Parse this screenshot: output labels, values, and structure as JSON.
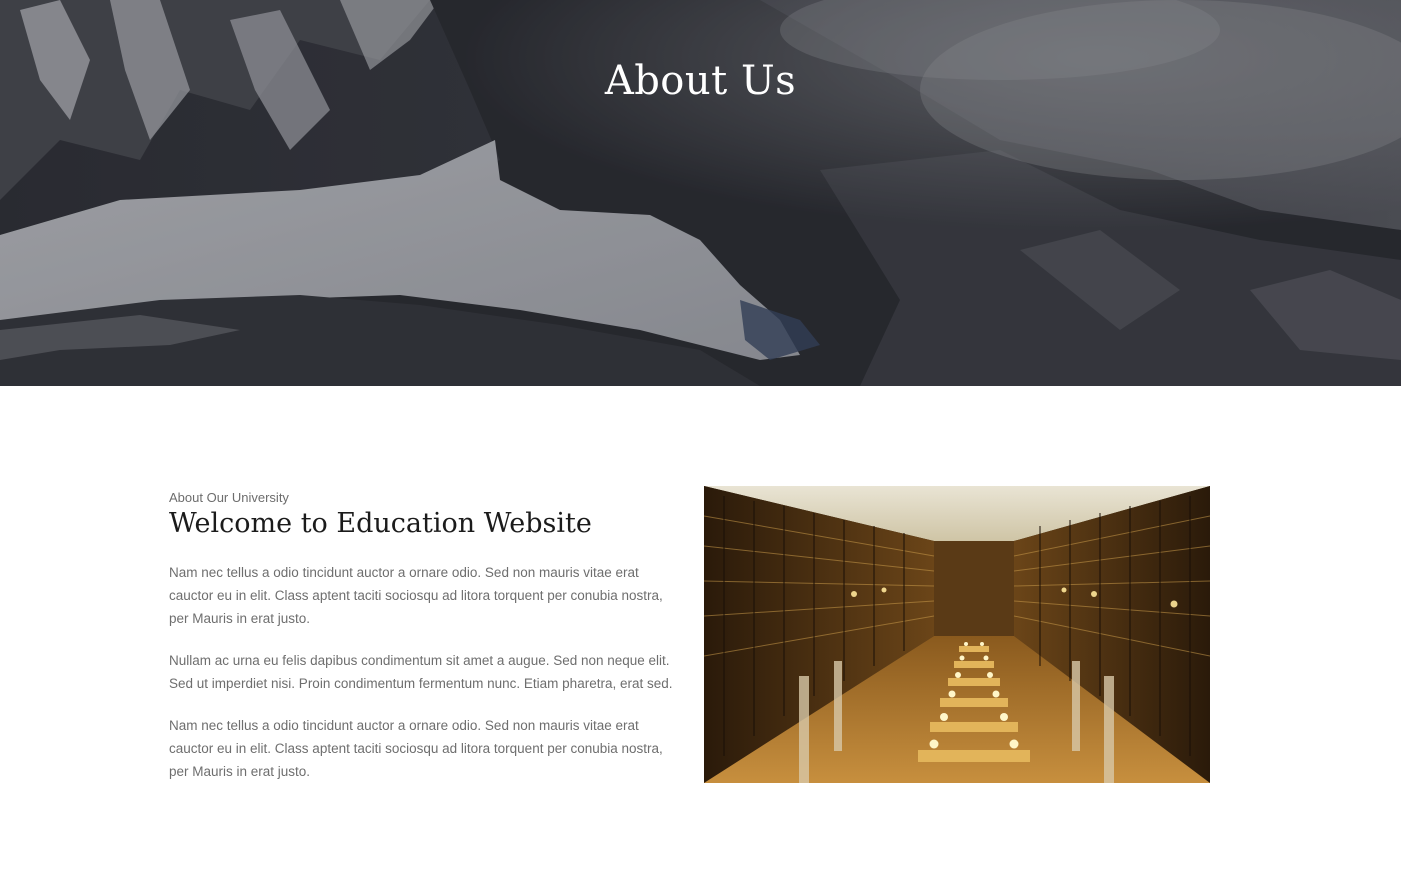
{
  "hero": {
    "title": "About Us",
    "image": "snowy-mountain-lake-photo"
  },
  "about": {
    "eyebrow": "About Our University",
    "heading": "Welcome to Education Website",
    "paragraphs": [
      "Nam nec tellus a odio tincidunt auctor a ornare odio. Sed non mauris vitae erat cauctor eu in elit. Class aptent taciti sociosqu ad litora torquent per conubia nostra, per Mauris in erat justo.",
      "Nullam ac urna eu felis dapibus condimentum sit amet a augue. Sed non neque elit. Sed ut imperdiet nisi. Proin condimentum fermentum nunc. Etiam pharetra, erat sed.",
      "Nam nec tellus a odio tincidunt auctor a ornare odio. Sed non mauris vitae erat cauctor eu in elit. Class aptent taciti sociosqu ad litora torquent per conubia nostra, per Mauris in erat justo."
    ],
    "image": "library-reading-room-photo"
  },
  "colors": {
    "heading": "#1b1b1b",
    "body_text": "#6e6e6e",
    "hero_title": "#ffffff"
  }
}
